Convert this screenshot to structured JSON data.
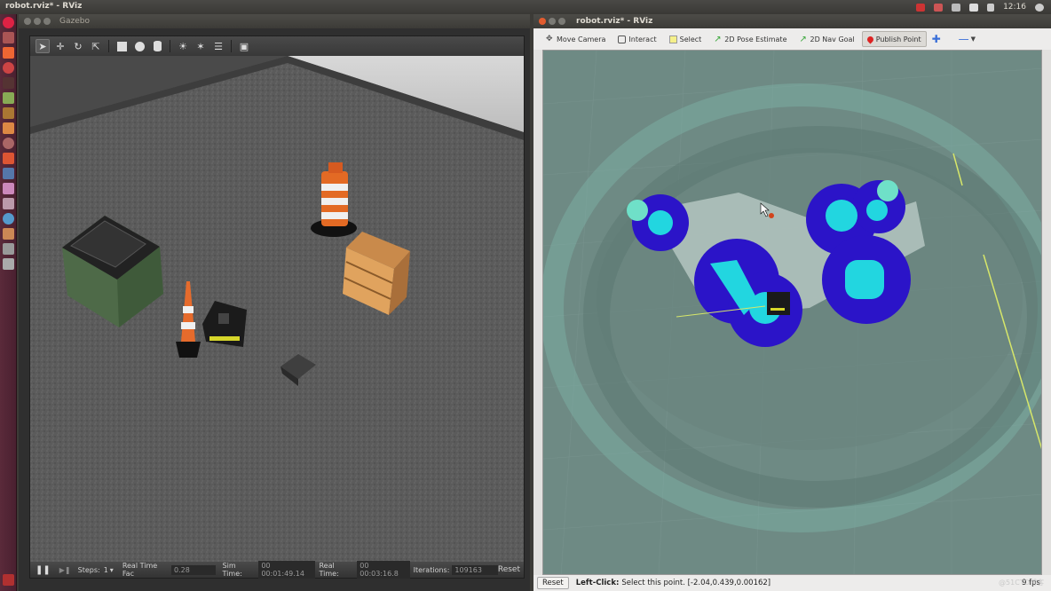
{
  "top_panel": {
    "window_title": "robot.rviz* - RViz",
    "clock": "12:16"
  },
  "gazebo": {
    "title": "Gazebo",
    "toolbar_icons": [
      "select-arrow-icon",
      "translate-icon",
      "rotate-icon",
      "scale-icon",
      "box-icon",
      "sphere-icon",
      "cylinder-icon",
      "point-light-icon",
      "spot-light-icon",
      "directional-light-icon",
      "screenshot-icon"
    ],
    "bottom": {
      "steps_label": "Steps:",
      "steps_value": "1",
      "rtf_label": "Real Time Fac",
      "rtf_value": "0.28",
      "sim_time_label": "Sim Time:",
      "sim_time_value": "00 00:01:49.14",
      "real_time_label": "Real Time:",
      "real_time_value": "00 00:03:16.8",
      "iterations_label": "Iterations:",
      "iterations_value": "109163",
      "reset_label": "Reset"
    }
  },
  "rviz": {
    "title": "robot.rviz* - RViz",
    "tools": [
      {
        "label": "Move Camera",
        "icon": "move-camera-icon"
      },
      {
        "label": "Interact",
        "icon": "interact-hand-icon"
      },
      {
        "label": "Select",
        "icon": "select-box-icon"
      },
      {
        "label": "2D Pose Estimate",
        "icon": "pose-estimate-arrow-icon"
      },
      {
        "label": "2D Nav Goal",
        "icon": "nav-goal-arrow-icon"
      },
      {
        "label": "Publish Point",
        "icon": "publish-point-pin-icon"
      }
    ],
    "status": {
      "reset_label": "Reset",
      "hint_label": "Left-Click:",
      "hint_text": "Select this point. [-2.04,0.439,0.00162]",
      "fps": "9 fps"
    }
  },
  "watermark": "@51CTO博客"
}
